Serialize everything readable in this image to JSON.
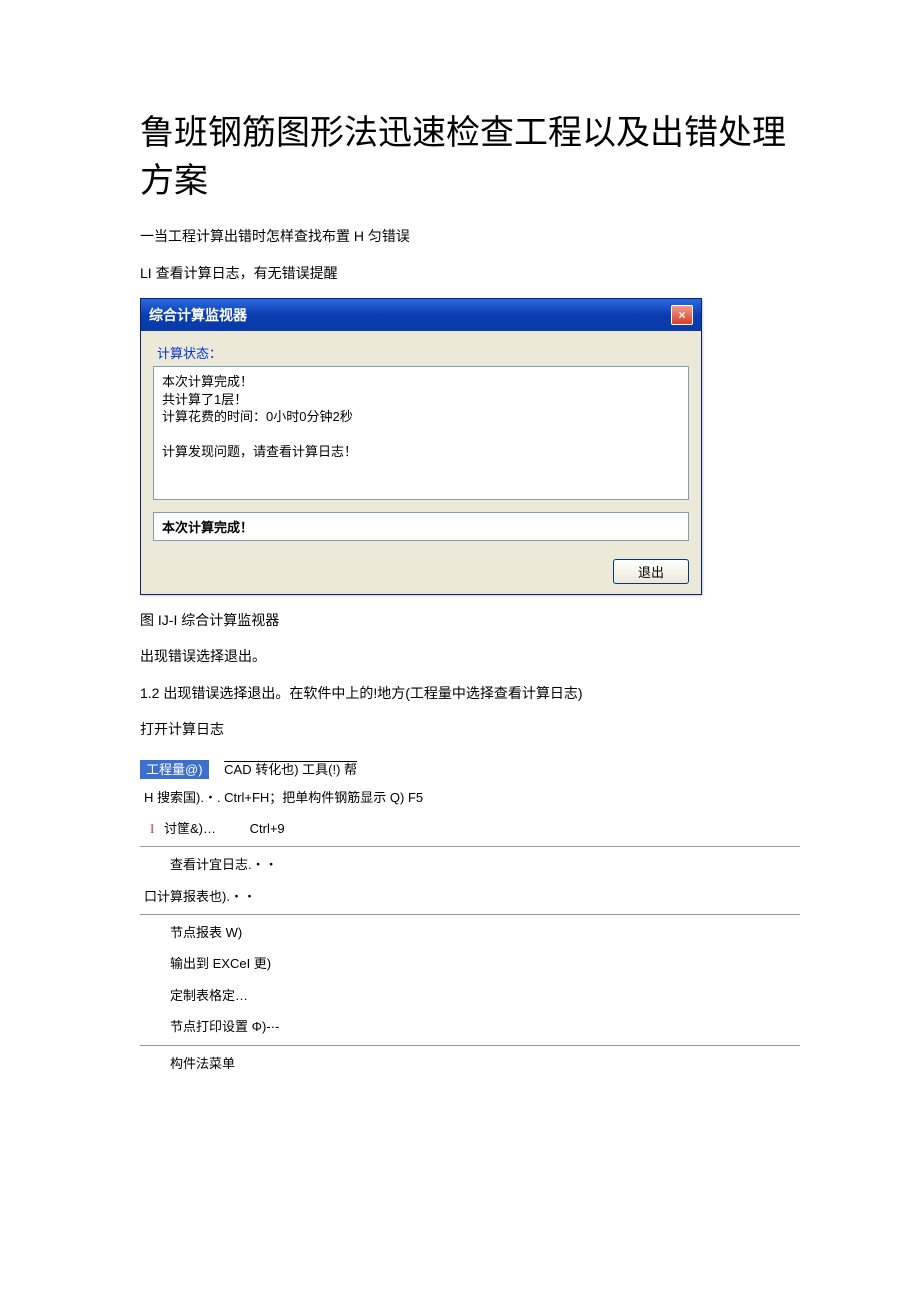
{
  "title": "鲁班钢筋图形法迅速检查工程以及出错处理方案",
  "para1": "一当工程计算出错时怎样查找布置 H 匀错误",
  "para2": "LI 查看计算日志，有无错误提醒",
  "dialog": {
    "title": "综合计算监视器",
    "close": "×",
    "group_label": "计算状态：",
    "log_text": "本次计算完成！\n共计算了1层！\n计算花费的时间：0小时0分钟2秒\n\n计算发现问题，请查看计算日志！",
    "status": "本次计算完成！",
    "exit": "退出"
  },
  "caption": "图 IJ-I 综合计算监视器",
  "para3": "出现错误选择退出。",
  "para4": "1.2   出现错误选择退出。在软件中上的!地方(工程量中选择查看计算日志)",
  "para5": "打开计算日志",
  "menu": {
    "top_highlight": "工程量@)",
    "top_rest": "CAD 转化也) 工具(!) 帮",
    "row_search": "H 搜索国).・. Ctrl+FH；把单构件钢筋显示 Q) F5",
    "row_calc_label": "讨筐&)…",
    "row_calc_shortcut": "Ctrl+9",
    "row_viewlog": "查看计宜日志.・・",
    "row_report": "口计算报表也).・・",
    "row_node": "节点报表 W)",
    "row_excel": "输出到 EXCeI 更)",
    "row_custom": "定制表格定…",
    "row_print": "节点打印设置 Φ)-·-",
    "row_component": "构件法菜单"
  }
}
